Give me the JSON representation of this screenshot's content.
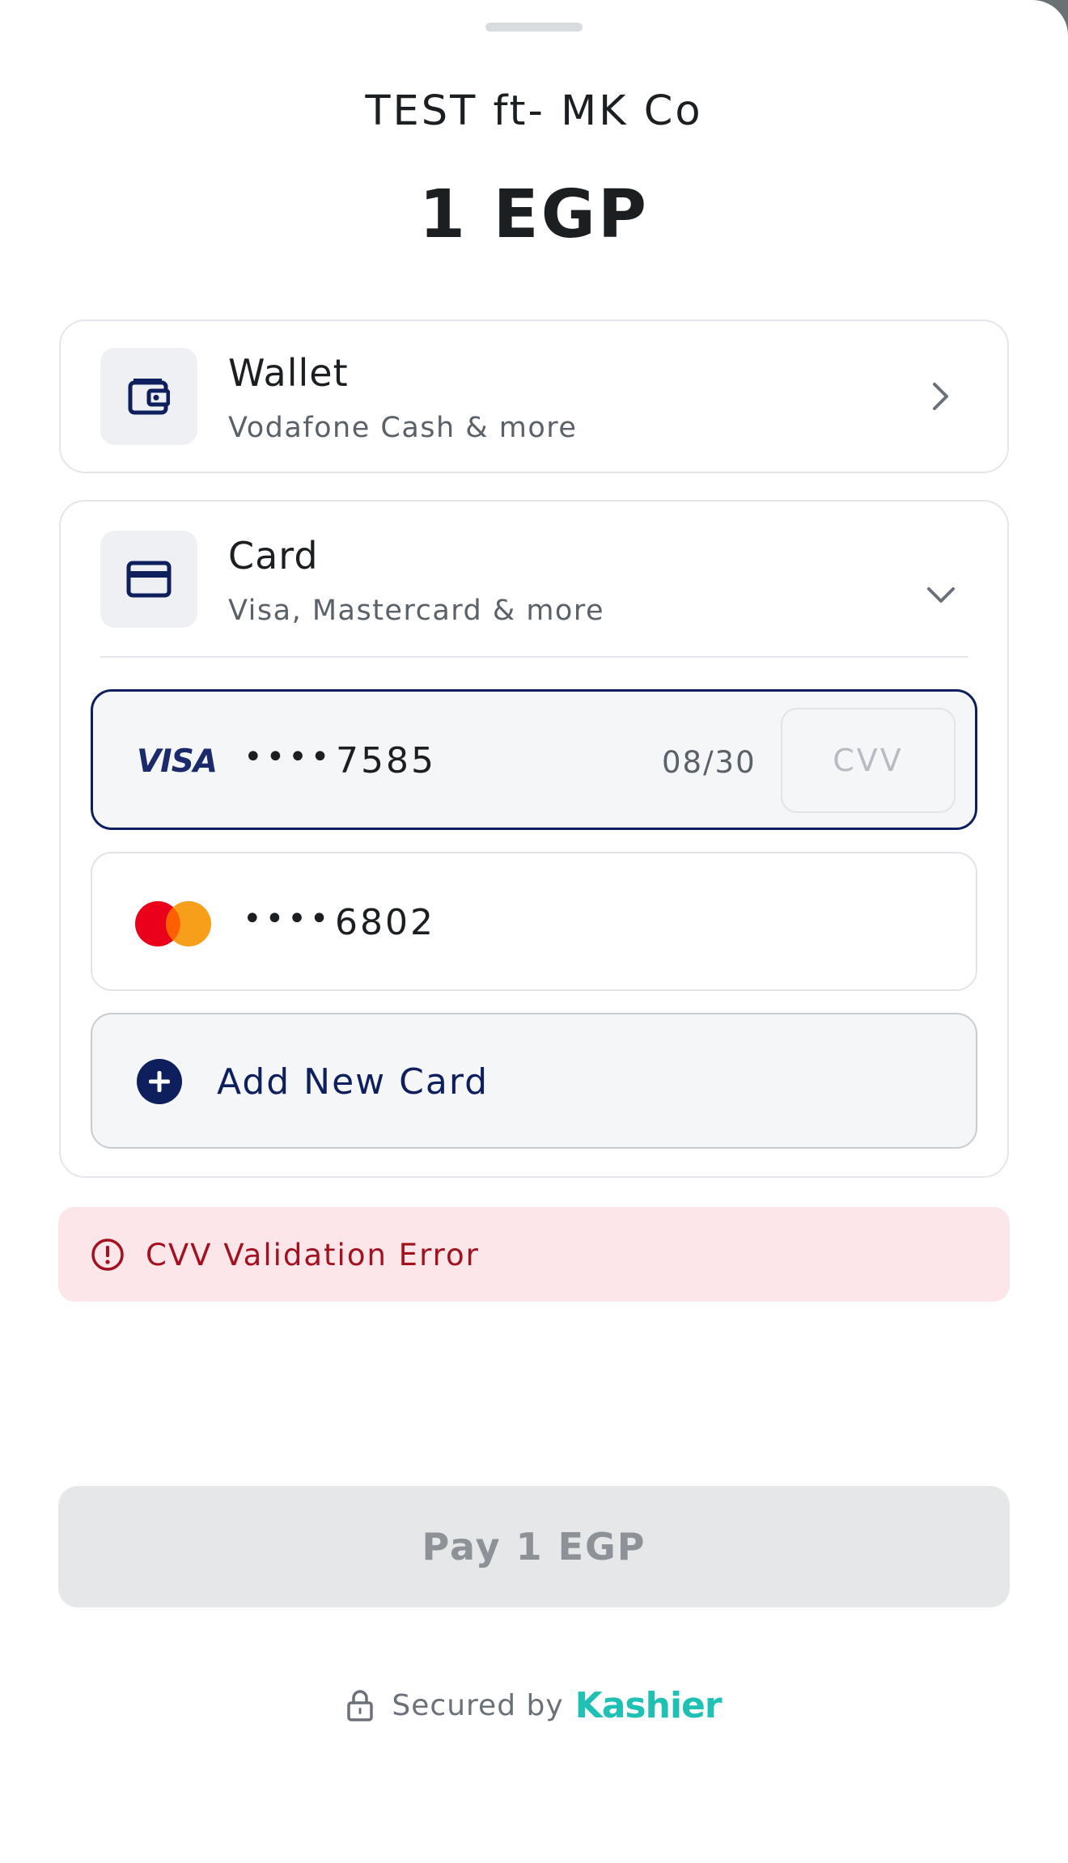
{
  "header": {
    "merchant_name": "TEST ft- MK Co",
    "amount": "1 EGP"
  },
  "payment_options": {
    "wallet": {
      "title": "Wallet",
      "subtitle": "Vodafone Cash & more",
      "icon": "wallet-icon",
      "expanded": false
    },
    "card": {
      "title": "Card",
      "subtitle": "Visa, Mastercard & more",
      "icon": "credit-card-icon",
      "expanded": true
    }
  },
  "saved_cards": [
    {
      "brand": "VISA",
      "masked": "••••",
      "last4": "7585",
      "expiry": "08/30",
      "cvv_placeholder": "CVV",
      "selected": true
    },
    {
      "brand": "mastercard",
      "masked": "••••",
      "last4": "6802",
      "selected": false
    }
  ],
  "add_card": {
    "label": "Add New Card",
    "icon": "plus-circle-icon"
  },
  "error": {
    "message": "CVV Validation Error",
    "icon": "alert-circle-icon"
  },
  "pay_button": {
    "label": "Pay 1 EGP",
    "enabled": false
  },
  "footer": {
    "secured_text": "Secured by",
    "brand": "Kashier",
    "icon": "lock-icon"
  },
  "colors": {
    "primary_navy": "#0d1f5c",
    "error_text": "#a3111f",
    "error_background": "#fde6e9",
    "brand_teal": "#1ec1b3",
    "disabled_button": "#e5e7e8"
  }
}
